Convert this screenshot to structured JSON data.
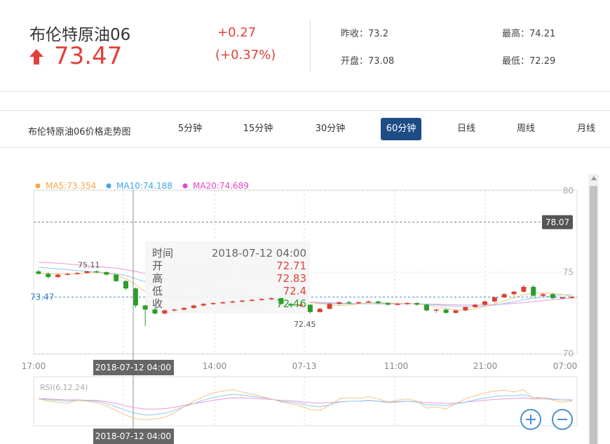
{
  "quote": {
    "name": "布伦特原油06",
    "price": "73.47",
    "change": "+0.27",
    "change_pct": "(+0.37%)",
    "prev_close_label": "昨收：",
    "prev_close": "73.2",
    "open_label": "开盘：",
    "open": "73.08",
    "high_label": "最高：",
    "high": "74.21",
    "low_label": "最低：",
    "low": "72.29",
    "up_color": "#e2403a",
    "icon": "up-arrow-icon"
  },
  "nav": {
    "title": "布伦特原油06价格走势图",
    "tabs": [
      "5分钟",
      "15分钟",
      "30分钟",
      "60分钟",
      "日线",
      "周线",
      "月线"
    ],
    "active_tab": "60分钟",
    "active_color": "#1e4d86"
  },
  "zoom": {
    "zoom_in_icon": "zoom-in-icon",
    "zoom_out_icon": "zoom-out-icon"
  },
  "chart_data": {
    "type": "candlestick",
    "legend": [
      {
        "label": "MA5:73.354",
        "color": "#f5a642"
      },
      {
        "label": "MA10:74.188",
        "color": "#3ea7e8"
      },
      {
        "label": "MA20:74.689",
        "color": "#e546c2"
      }
    ],
    "y_ticks": [
      80,
      75,
      70
    ],
    "ylim": [
      70,
      80
    ],
    "x_ticks": [
      "17:00",
      "14:00",
      "07-13",
      "11:00",
      "21:00",
      "07:00"
    ],
    "last_price": 73.47,
    "last_price_label": "73.47",
    "ref_line": 78.07,
    "ref_line_label": "78.07",
    "max_label": "75.11",
    "min_label": "72.45",
    "crosshair_date": "2018-07-12 04:00",
    "up_color": "#d94030",
    "down_color": "#2a9d2a",
    "candles": [
      [
        75.05,
        75.12,
        74.85,
        74.9
      ],
      [
        74.9,
        74.98,
        74.6,
        74.7
      ],
      [
        74.7,
        74.9,
        74.65,
        74.85
      ],
      [
        74.85,
        74.95,
        74.8,
        74.9
      ],
      [
        74.9,
        75.0,
        74.85,
        74.95
      ],
      [
        74.95,
        75.08,
        74.92,
        75.05
      ],
      [
        75.05,
        75.11,
        74.95,
        75.0
      ],
      [
        75.0,
        75.05,
        74.8,
        74.85
      ],
      [
        74.85,
        74.88,
        74.4,
        74.45
      ],
      [
        74.45,
        74.5,
        73.9,
        74.0
      ],
      [
        74.0,
        74.05,
        72.8,
        72.95
      ],
      [
        72.95,
        73.0,
        71.7,
        72.7
      ],
      [
        72.71,
        72.83,
        72.4,
        72.46
      ],
      [
        72.46,
        72.7,
        72.4,
        72.65
      ],
      [
        72.65,
        72.75,
        72.6,
        72.7
      ],
      [
        72.7,
        72.85,
        72.65,
        72.8
      ],
      [
        72.8,
        73.0,
        72.75,
        72.95
      ],
      [
        72.95,
        73.1,
        72.9,
        73.05
      ],
      [
        73.05,
        73.15,
        73.0,
        73.1
      ],
      [
        73.1,
        73.2,
        73.05,
        73.15
      ],
      [
        73.15,
        73.25,
        73.1,
        73.2
      ],
      [
        73.2,
        73.3,
        73.15,
        73.25
      ],
      [
        73.25,
        73.35,
        73.2,
        73.3
      ],
      [
        73.3,
        73.4,
        73.25,
        73.35
      ],
      [
        73.35,
        73.45,
        73.3,
        73.4
      ],
      [
        73.4,
        73.45,
        73.0,
        73.05
      ],
      [
        73.05,
        73.1,
        72.9,
        72.95
      ],
      [
        72.95,
        73.05,
        72.85,
        73.0
      ],
      [
        73.0,
        73.02,
        72.45,
        72.55
      ],
      [
        72.55,
        72.8,
        72.5,
        72.75
      ],
      [
        72.75,
        73.1,
        72.7,
        73.05
      ],
      [
        73.05,
        73.2,
        73.0,
        73.15
      ],
      [
        73.15,
        73.25,
        73.05,
        73.1
      ],
      [
        73.1,
        73.2,
        73.05,
        73.15
      ],
      [
        73.15,
        73.25,
        73.1,
        73.2
      ],
      [
        73.2,
        73.25,
        73.05,
        73.1
      ],
      [
        73.1,
        73.15,
        72.95,
        73.0
      ],
      [
        73.0,
        73.1,
        72.95,
        73.05
      ],
      [
        73.05,
        73.15,
        73.0,
        73.1
      ],
      [
        73.1,
        73.15,
        72.95,
        73.0
      ],
      [
        73.0,
        73.05,
        72.6,
        72.65
      ],
      [
        72.65,
        72.75,
        72.5,
        72.7
      ],
      [
        72.7,
        72.75,
        72.45,
        72.5
      ],
      [
        72.5,
        72.7,
        72.45,
        72.65
      ],
      [
        72.65,
        72.9,
        72.6,
        72.85
      ],
      [
        72.85,
        73.05,
        72.8,
        73.0
      ],
      [
        73.0,
        73.25,
        72.95,
        73.2
      ],
      [
        73.2,
        73.5,
        73.15,
        73.45
      ],
      [
        73.45,
        73.7,
        73.4,
        73.65
      ],
      [
        73.65,
        73.85,
        73.55,
        73.8
      ],
      [
        73.8,
        74.21,
        73.75,
        74.1
      ],
      [
        74.1,
        74.2,
        73.5,
        73.55
      ],
      [
        73.55,
        73.7,
        73.45,
        73.65
      ],
      [
        73.65,
        73.7,
        73.35,
        73.4
      ],
      [
        73.4,
        73.5,
        73.35,
        73.45
      ],
      [
        73.45,
        73.55,
        73.4,
        73.47
      ]
    ],
    "ma5": [
      74.9,
      74.9,
      74.9,
      74.88,
      74.9,
      74.95,
      74.97,
      74.93,
      74.85,
      74.6,
      74.25,
      73.8,
      73.35,
      72.95,
      72.7,
      72.65,
      72.7,
      72.78,
      72.87,
      72.96,
      73.04,
      73.12,
      73.18,
      73.23,
      73.28,
      73.3,
      73.26,
      73.22,
      73.14,
      73.06,
      73.0,
      72.95,
      72.97,
      73.05,
      73.12,
      73.14,
      73.12,
      73.09,
      73.07,
      73.05,
      72.98,
      72.88,
      72.78,
      72.68,
      72.66,
      72.74,
      72.88,
      73.05,
      73.24,
      73.42,
      73.62,
      73.72,
      73.72,
      73.7,
      73.62,
      73.5
    ],
    "ma10": [
      75.3,
      75.25,
      75.2,
      75.15,
      75.1,
      75.05,
      75.0,
      74.95,
      74.9,
      74.8,
      74.6,
      74.4,
      74.15,
      73.9,
      73.65,
      73.45,
      73.3,
      73.2,
      73.1,
      73.05,
      73.0,
      73.0,
      73.02,
      73.05,
      73.08,
      73.1,
      73.12,
      73.13,
      73.12,
      73.1,
      73.08,
      73.06,
      73.05,
      73.05,
      73.06,
      73.07,
      73.08,
      73.08,
      73.08,
      73.06,
      73.03,
      72.99,
      72.94,
      72.9,
      72.87,
      72.88,
      72.92,
      72.98,
      73.07,
      73.18,
      73.3,
      73.4,
      73.48,
      73.55,
      73.6,
      73.62
    ],
    "ma20": [
      75.6,
      75.58,
      75.55,
      75.5,
      75.45,
      75.4,
      75.35,
      75.3,
      75.25,
      75.15,
      75.05,
      74.9,
      74.75,
      74.6,
      74.45,
      74.3,
      74.15,
      74.0,
      73.88,
      73.76,
      73.65,
      73.55,
      73.47,
      73.4,
      73.34,
      73.28,
      73.24,
      73.2,
      73.17,
      73.14,
      73.12,
      73.1,
      73.08,
      73.07,
      73.06,
      73.05,
      73.05,
      73.05,
      73.05,
      73.05,
      73.04,
      73.03,
      73.01,
      72.99,
      72.98,
      72.98,
      72.99,
      73.01,
      73.04,
      73.08,
      73.13,
      73.19,
      73.25,
      73.31,
      73.36,
      73.4
    ],
    "tooltip": {
      "time_label": "时间",
      "time": "2018-07-12 04:00",
      "open_label": "开",
      "open": "72.71",
      "high_label": "高",
      "high": "72.83",
      "low_label": "低",
      "low": "72.4",
      "close_label": "收",
      "close": "72.46"
    },
    "rsi": {
      "label": "RSI(6,12,24)",
      "ylim": [
        0,
        100
      ],
      "rsi6": [
        55,
        50,
        48,
        45,
        52,
        50,
        47,
        40,
        30,
        20,
        12,
        10,
        12,
        15,
        25,
        38,
        50,
        60,
        68,
        72,
        75,
        70,
        65,
        60,
        55,
        48,
        45,
        40,
        32,
        30,
        42,
        55,
        58,
        56,
        60,
        55,
        48,
        52,
        55,
        50,
        35,
        38,
        33,
        45,
        55,
        62,
        68,
        72,
        74,
        70,
        75,
        55,
        58,
        52,
        48,
        50
      ],
      "rsi12": [
        55,
        53,
        52,
        50,
        52,
        51,
        50,
        45,
        38,
        30,
        24,
        20,
        21,
        24,
        30,
        38,
        45,
        52,
        58,
        62,
        65,
        63,
        60,
        58,
        55,
        50,
        48,
        45,
        40,
        38,
        42,
        48,
        50,
        50,
        52,
        50,
        47,
        48,
        50,
        48,
        42,
        42,
        40,
        44,
        48,
        53,
        57,
        60,
        62,
        62,
        64,
        58,
        58,
        55,
        53,
        52
      ],
      "rsi24": [
        56,
        55,
        54,
        53,
        53,
        52,
        52,
        49,
        45,
        40,
        36,
        33,
        33,
        34,
        37,
        41,
        45,
        48,
        52,
        55,
        57,
        57,
        56,
        55,
        54,
        52,
        51,
        49,
        47,
        46,
        47,
        49,
        50,
        50,
        51,
        50,
        49,
        49,
        50,
        49,
        47,
        46,
        45,
        46,
        48,
        50,
        52,
        54,
        55,
        56,
        57,
        55,
        55,
        54,
        53,
        53
      ]
    }
  }
}
